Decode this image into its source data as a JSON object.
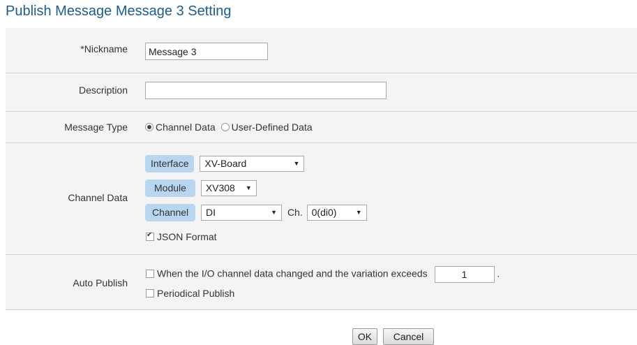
{
  "page": {
    "title": "Publish Message Message 3 Setting"
  },
  "form": {
    "nickname": {
      "label": "*Nickname",
      "value": "Message 3"
    },
    "description": {
      "label": "Description",
      "value": ""
    },
    "message_type": {
      "label": "Message Type",
      "options": [
        "Channel Data",
        "User-Defined Data"
      ],
      "selected": "Channel Data"
    },
    "channel_data": {
      "label": "Channel Data",
      "interface": {
        "tag": "Interface",
        "value": "XV-Board"
      },
      "module": {
        "tag": "Module",
        "value": "XV308"
      },
      "channel": {
        "tag": "Channel",
        "value": "DI",
        "ch_label": "Ch.",
        "ch_value": "0(di0)"
      },
      "json_format": {
        "label": "JSON Format",
        "checked": true
      }
    },
    "auto_publish": {
      "label": "Auto Publish",
      "on_change": {
        "label": "When the I/O channel data changed and the variation exceeds",
        "checked": false,
        "value": "1",
        "suffix": "."
      },
      "periodical": {
        "label": "Periodical Publish",
        "checked": false
      }
    }
  },
  "buttons": {
    "ok": "OK",
    "cancel": "Cancel"
  },
  "colors": {
    "title": "#1c5d8c",
    "tag_bg": "#b9d6f0",
    "panel_bg": "#f4f4f4"
  },
  "icons": {
    "dropdown": "triangle-down-icon",
    "radio": "radio-icon",
    "checkbox": "checkbox-icon"
  }
}
